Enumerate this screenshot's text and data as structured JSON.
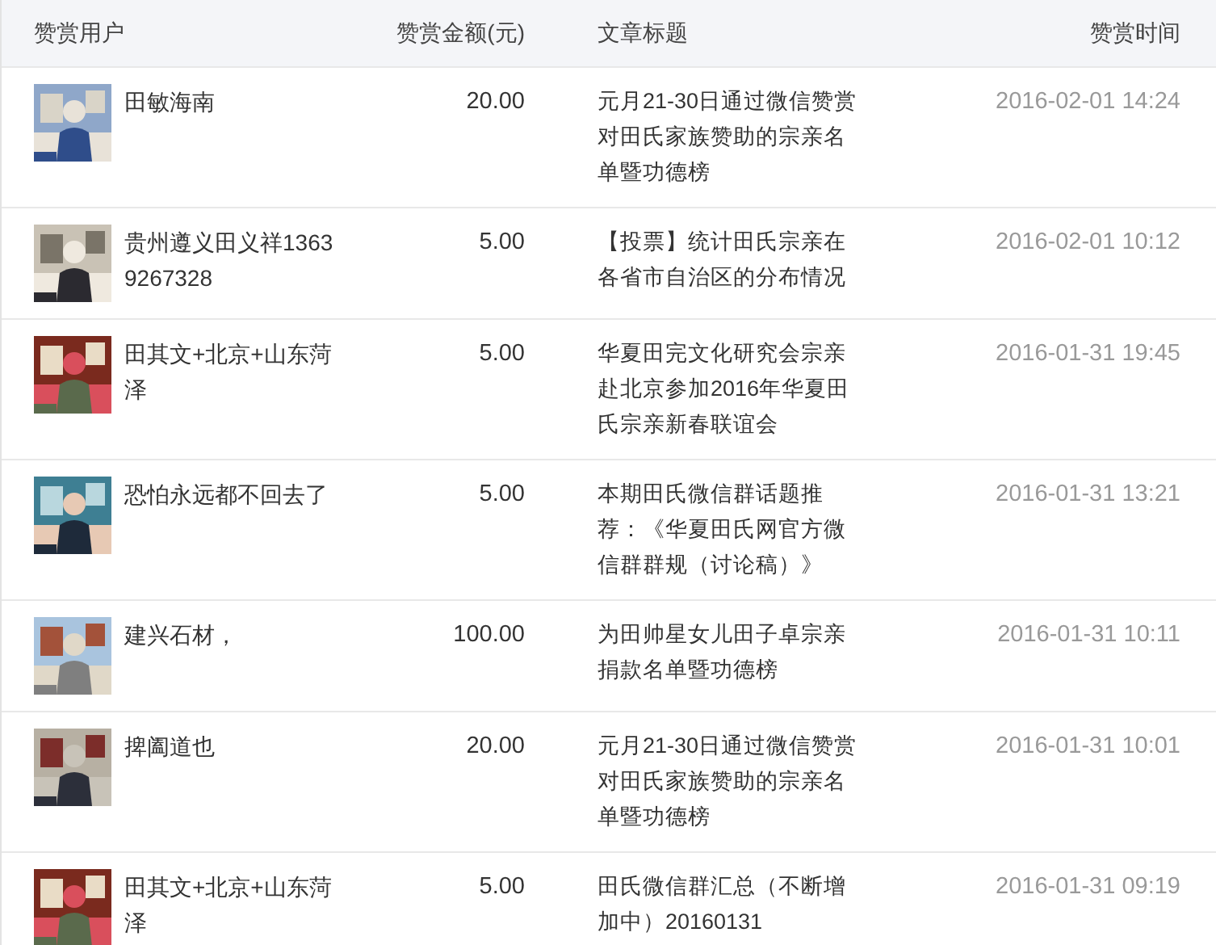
{
  "table": {
    "columns": [
      "赞赏用户",
      "赞赏金额(元)",
      "文章标题",
      "赞赏时间"
    ],
    "rows": [
      {
        "user": "田敏海南",
        "amount": "20.00",
        "title": "元月21-30日通过微信赞赏对田氏家族赞助的宗亲名单暨功德榜",
        "time": "2016-02-01 14:24"
      },
      {
        "user": "贵州遵义田义祥13639267328",
        "amount": "5.00",
        "title": "【投票】统计田氏宗亲在各省市自治区的分布情况",
        "time": "2016-02-01 10:12"
      },
      {
        "user": "田其文+北京+山东菏泽",
        "amount": "5.00",
        "title": "华夏田完文化研究会宗亲赴北京参加2016年华夏田氏宗亲新春联谊会",
        "time": "2016-01-31 19:45"
      },
      {
        "user": "恐怕永远都不回去了",
        "amount": "5.00",
        "title": "本期田氏微信群话题推荐：《华夏田氏网官方微信群群规（讨论稿）》",
        "time": "2016-01-31 13:21"
      },
      {
        "user": "建兴石材，",
        "amount": "100.00",
        "title": "为田帅星女儿田子卓宗亲捐款名单暨功德榜",
        "time": "2016-01-31 10:11"
      },
      {
        "user": "捭阖道也",
        "amount": "20.00",
        "title": "元月21-30日通过微信赞赏对田氏家族赞助的宗亲名单暨功德榜",
        "time": "2016-01-31 10:01"
      },
      {
        "user": "田其文+北京+山东菏泽",
        "amount": "5.00",
        "title": "田氏微信群汇总（不断增加中）20160131",
        "time": "2016-01-31 09:19"
      }
    ]
  }
}
